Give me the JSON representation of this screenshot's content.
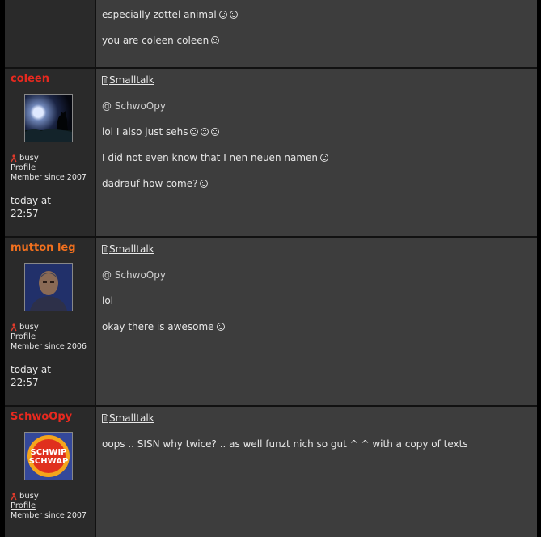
{
  "colors": {
    "username_red": "#e8291f",
    "username_orange": "#f2701e"
  },
  "top_post": {
    "lines": [
      {
        "text": "especially zottel animal",
        "smileys": 2
      },
      {
        "text": "you are coleen coleen",
        "smileys": 1
      }
    ]
  },
  "posts": [
    {
      "username": "coleen",
      "username_color": "#e8291f",
      "avatar": "cat-silhouette-night-avatar",
      "status": "busy",
      "profile_label": "Profile",
      "member_since": "Member since 2007",
      "time_line1": "today at",
      "time_line2": "22:57",
      "topic": "Smalltalk",
      "lines": [
        {
          "text": "@ SchwoOpy",
          "smileys": 0,
          "mention": true
        },
        {
          "text": "lol I also just sehs",
          "smileys": 3
        },
        {
          "text": "I did not even know that I nen neuen namen",
          "smileys": 1
        },
        {
          "text": "dadrauf how come?",
          "smileys": 1
        }
      ]
    },
    {
      "username": "mutton leg",
      "username_color": "#f2701e",
      "avatar": "man-portrait-avatar",
      "status": "busy",
      "profile_label": "Profile",
      "member_since": "Member since 2006",
      "time_line1": "today at",
      "time_line2": "22:57",
      "topic": "Smalltalk",
      "lines": [
        {
          "text": "@ SchwoOpy",
          "smileys": 0,
          "mention": true
        },
        {
          "text": "lol",
          "smileys": 0
        },
        {
          "text": "okay there is awesome",
          "smileys": 1
        }
      ]
    },
    {
      "username": "SchwoOpy",
      "username_color": "#e8291f",
      "avatar": "schwip-schwap-logo-avatar",
      "avatar_text_1": "SCHWIP",
      "avatar_text_2": "SCHWAP",
      "status": "busy",
      "profile_label": "Profile",
      "member_since": "Member since 2007",
      "topic": "Smalltalk",
      "lines": [
        {
          "text": "oops .. SISN why twice? .. as well funzt nich so gut ^ ^ with a copy of texts",
          "smileys": 0
        }
      ]
    }
  ]
}
